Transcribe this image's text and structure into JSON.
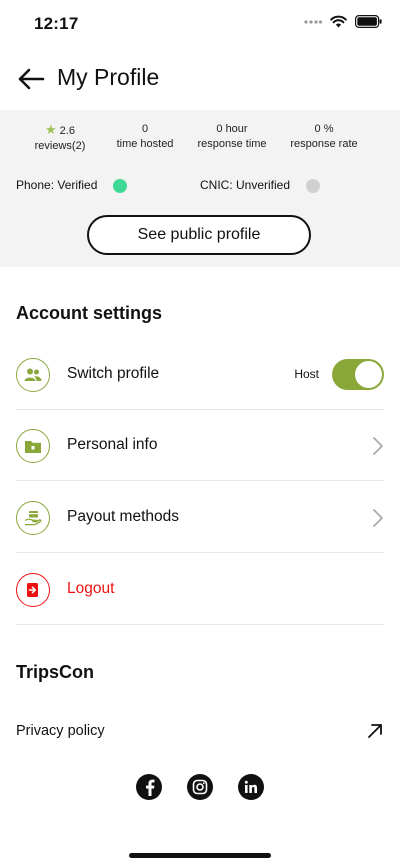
{
  "status_bar": {
    "time": "12:17"
  },
  "header": {
    "title": "My Profile"
  },
  "stats": {
    "reviews": {
      "value": "2.6",
      "label": "reviews(2)"
    },
    "hosted": {
      "value": "0",
      "label": "time hosted"
    },
    "response_time": {
      "value": "0 hour",
      "label": "response time"
    },
    "response_rate": {
      "value": "0 %",
      "label": "response rate"
    }
  },
  "verification": {
    "phone": "Phone: Verified",
    "cnic": "CNIC: Unverified",
    "colors": {
      "verified": "#3fd995",
      "unverified": "#d0d0d0"
    }
  },
  "public_profile_button": "See public profile",
  "account_settings": {
    "title": "Account settings",
    "items": [
      {
        "label": "Switch profile",
        "icon": "users-icon",
        "toggle_label": "Host",
        "toggle_on": true
      },
      {
        "label": "Personal info",
        "icon": "folder-icon"
      },
      {
        "label": "Payout methods",
        "icon": "payout-icon"
      },
      {
        "label": "Logout",
        "icon": "logout-icon"
      }
    ]
  },
  "tripscon": {
    "title": "TripsCon",
    "privacy_label": "Privacy policy"
  },
  "social": [
    "facebook-icon",
    "instagram-icon",
    "linkedin-icon"
  ],
  "colors": {
    "accent": "#8aa83a",
    "danger": "#ee1111",
    "panel_bg": "#f3f3f3",
    "star": "#9bc35a"
  }
}
